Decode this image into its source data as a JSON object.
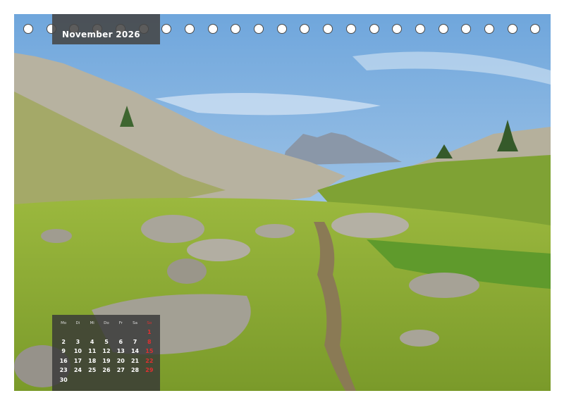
{
  "calendar": {
    "month_title": "November 2026",
    "weekdays": [
      "Mo",
      "Di",
      "Mi",
      "Do",
      "Fr",
      "Sa",
      "So"
    ],
    "weeks": [
      [
        "",
        "",
        "",
        "",
        "",
        "",
        "1"
      ],
      [
        "2",
        "3",
        "4",
        "5",
        "6",
        "7",
        "8"
      ],
      [
        "9",
        "10",
        "11",
        "12",
        "13",
        "14",
        "15"
      ],
      [
        "16",
        "17",
        "18",
        "19",
        "20",
        "21",
        "22"
      ],
      [
        "23",
        "24",
        "25",
        "26",
        "27",
        "28",
        "29"
      ],
      [
        "30",
        "",
        "",
        "",
        "",
        "",
        ""
      ]
    ],
    "sunday_color": "#e03030",
    "binding_holes": 23
  },
  "photo": {
    "subject": "mountain-meadow-trail"
  }
}
